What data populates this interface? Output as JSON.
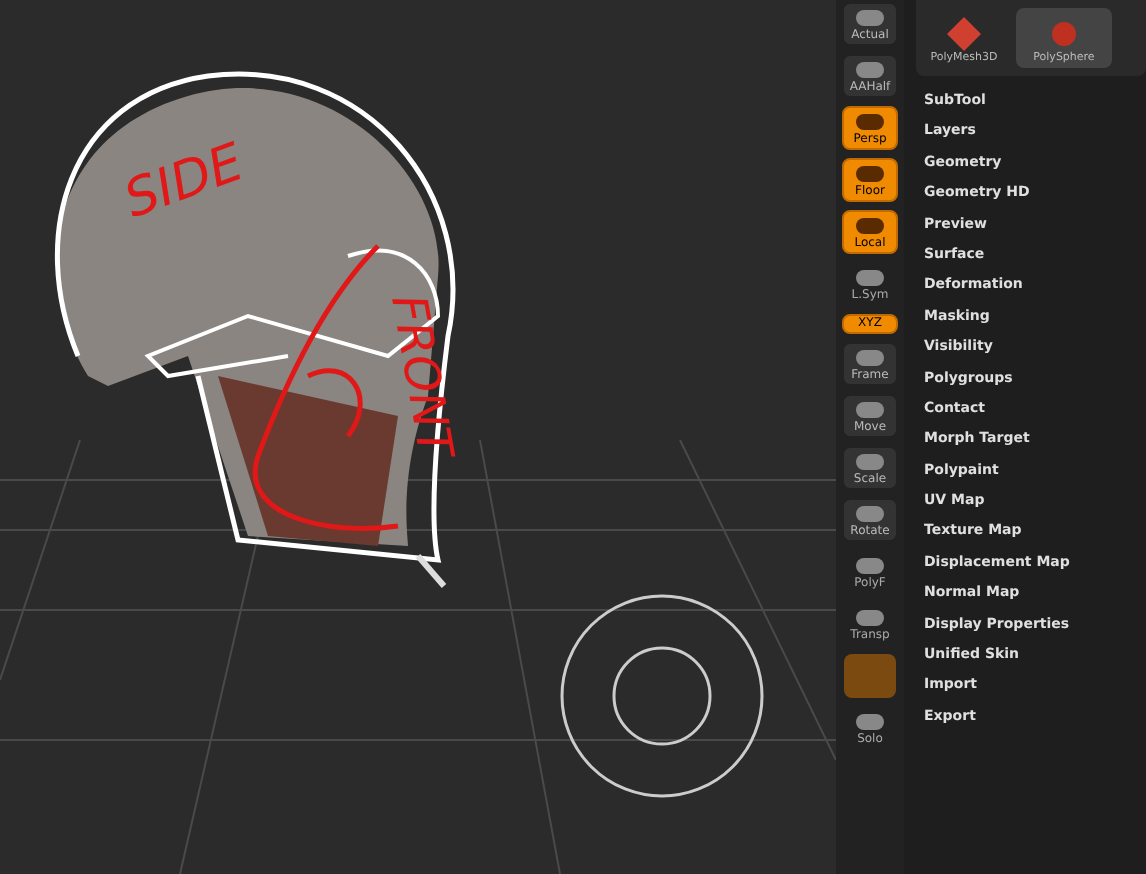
{
  "viewport": {
    "annotations": [
      {
        "text": "SIDE",
        "kind": "side"
      },
      {
        "text": "FRONT",
        "kind": "front"
      }
    ]
  },
  "toolbar": [
    {
      "label": "Actual",
      "on": false,
      "kind": "button"
    },
    {
      "label": "AAHalf",
      "on": false,
      "kind": "button"
    },
    {
      "label": "Persp",
      "on": true,
      "kind": "button"
    },
    {
      "label": "Floor",
      "on": true,
      "kind": "button"
    },
    {
      "label": "Local",
      "on": true,
      "kind": "button"
    },
    {
      "label": "L.Sym",
      "on": false,
      "kind": "flat"
    },
    {
      "label": "XYZ",
      "on": true,
      "kind": "slim"
    },
    {
      "label": "Frame",
      "on": false,
      "kind": "button"
    },
    {
      "label": "Move",
      "on": false,
      "kind": "button"
    },
    {
      "label": "Scale",
      "on": false,
      "kind": "button"
    },
    {
      "label": "Rotate",
      "on": false,
      "kind": "button"
    },
    {
      "label": "PolyF",
      "on": false,
      "kind": "flat"
    },
    {
      "label": "Transp",
      "on": false,
      "kind": "flat"
    },
    {
      "on": false,
      "kind": "swatch"
    },
    {
      "label": "Solo",
      "on": false,
      "kind": "flat"
    }
  ],
  "tools": [
    {
      "label": "PolyMesh3D",
      "selected": false
    },
    {
      "label": "PolySphere",
      "selected": true
    }
  ],
  "menu": [
    "SubTool",
    "Layers",
    "Geometry",
    "Geometry HD",
    "Preview",
    "Surface",
    "Deformation",
    "Masking",
    "Visibility",
    "Polygroups",
    "Contact",
    "Morph Target",
    "Polypaint",
    "UV Map",
    "Texture Map",
    "Displacement Map",
    "Normal Map",
    "Display Properties",
    "Unified Skin",
    "Import",
    "Export"
  ]
}
